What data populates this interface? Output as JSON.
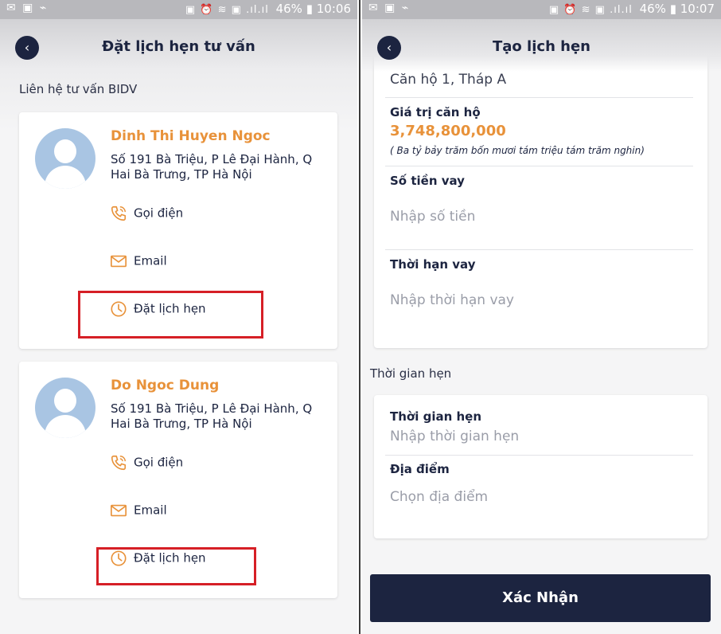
{
  "status_left": {
    "icons": "chat-bubble-icon image-icon activity-icon",
    "text": "✉ ▣ ⌁",
    "right_icons": "▣ ⏰ ≋ ▣ .ıl.ıl",
    "battery": "46%",
    "time": "10:06"
  },
  "status_right": {
    "text": "✉ ▣ ⌁",
    "right_icons": "▣ ⏰ ≋ ▣ .ıl.ıl",
    "battery": "46%",
    "time": "10:07"
  },
  "left": {
    "back_glyph": "‹",
    "title": "Đặt lịch hẹn tư vấn",
    "section": "Liên hệ tư vấn BIDV",
    "contacts": [
      {
        "name": "Dinh Thi Huyen Ngoc",
        "address": "Số 191 Bà Triệu, P Lê Đại Hành, Q Hai Bà Trưng, TP Hà Nội",
        "call": "Gọi điện",
        "email": "Email",
        "book": "Đặt lịch hẹn"
      },
      {
        "name": "Do Ngoc Dung",
        "address": "Số 191 Bà Triệu, P Lê Đại Hành, Q Hai Bà Trưng, TP Hà Nội",
        "call": "Gọi điện",
        "email": "Email",
        "book": "Đặt lịch hẹn"
      }
    ]
  },
  "right": {
    "back_glyph": "‹",
    "title": "Tạo lịch hẹn",
    "apartment": "Căn hộ 1, Tháp A",
    "value_label": "Giá trị căn hộ",
    "value": "3,748,800,000",
    "value_words": "( Ba tỷ bảy trăm bốn mươi tám triệu tám trăm nghin)",
    "loan_amount_label": "Số tiền vay",
    "loan_amount_placeholder": "Nhập số tiền",
    "loan_term_label": "Thời hạn vay",
    "loan_term_placeholder": "Nhập thời hạn vay",
    "appointment_section": "Thời gian hẹn",
    "appointment_time_label": "Thời gian hẹn",
    "appointment_time_placeholder": "Nhập thời gian hẹn",
    "location_label": "Địa điểm",
    "location_placeholder": "Chọn địa điểm",
    "confirm": "Xác Nhận"
  },
  "colors": {
    "navy": "#1c2440",
    "orange": "#e8923a",
    "highlight_red": "#d61f26",
    "avatar_blue": "#a9c5e3"
  }
}
